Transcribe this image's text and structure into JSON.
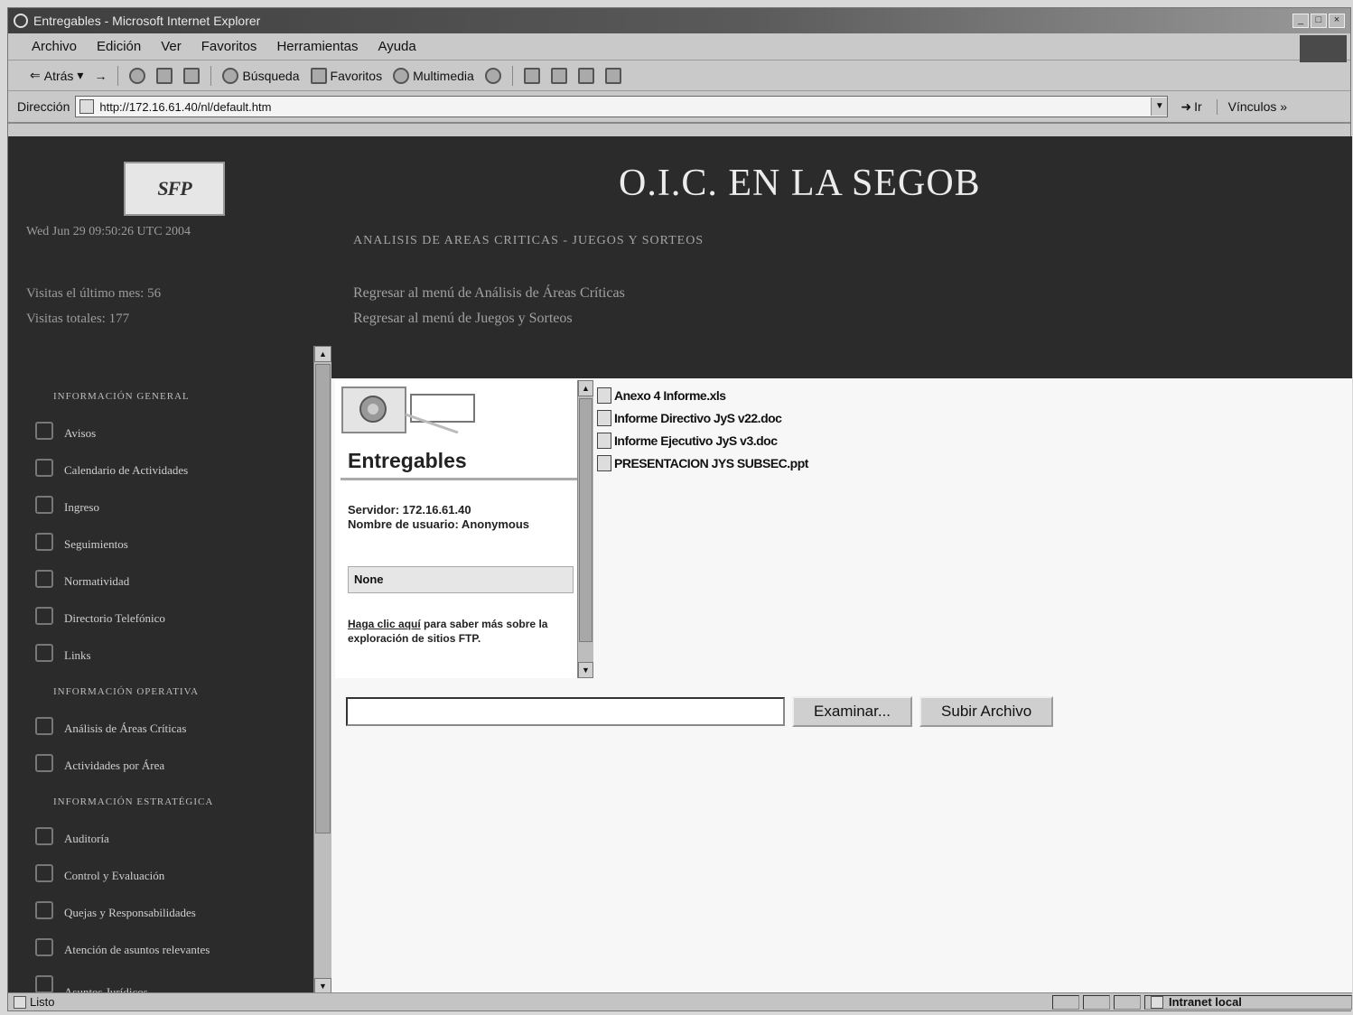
{
  "window": {
    "title": "Entregables - Microsoft Internet Explorer",
    "min": "_",
    "max": "□",
    "close": "×"
  },
  "menu": [
    "Archivo",
    "Edición",
    "Ver",
    "Favoritos",
    "Herramientas",
    "Ayuda"
  ],
  "toolbar": {
    "back": "Atrás",
    "forward": "→",
    "search": "Búsqueda",
    "favorites": "Favoritos",
    "media": "Multimedia"
  },
  "address": {
    "label": "Dirección",
    "url": "http://172.16.61.40/nl/default.htm",
    "go": "Ir",
    "links": "Vínculos"
  },
  "header": {
    "logo": "SFP",
    "datetime": "Wed Jun 29 09:50:26 UTC 2004",
    "visitor_last": "Visitas el último mes: 56",
    "visitor_total": "Visitas totales: 177",
    "site_title": "O.I.C. EN LA SEGOB",
    "subtitle": "ANALISIS DE AREAS CRITICAS - JUEGOS Y SORTEOS",
    "link1": "Regresar al menú de Análisis de Áreas Críticas",
    "link2": "Regresar al menú de Juegos y Sorteos"
  },
  "sidebar": {
    "section1": "INFORMACIÓN GENERAL",
    "items1": [
      "Avisos",
      "Calendario de Actividades",
      "Ingreso",
      "Seguimientos",
      "Normatividad",
      "Directorio Telefónico",
      "Links"
    ],
    "section2": "INFORMACIÓN OPERATIVA",
    "items2": [
      "Análisis de Áreas Críticas",
      "Actividades por Área"
    ],
    "section3": "INFORMACIÓN ESTRATÉGICA",
    "items3": [
      "Auditoría",
      "Control y Evaluación",
      "Quejas y Responsabilidades",
      "Atención de asuntos relevantes",
      "Asuntos Jurídicos"
    ]
  },
  "ftp": {
    "heading": "Entregables",
    "server": "Servidor: 172.16.61.40",
    "user": "Nombre de usuario: Anonymous",
    "select_value": "None",
    "help_link": "Haga clic aquí",
    "help_text": " para saber más sobre la exploración de sitios FTP."
  },
  "files": [
    "Anexo 4 Informe.xls",
    "Informe Directivo JyS v22.doc",
    "Informe Ejecutivo JyS v3.doc",
    "PRESENTACION JYS SUBSEC.ppt"
  ],
  "upload": {
    "browse": "Examinar...",
    "submit": "Subir Archivo"
  },
  "status": {
    "text": "Listo",
    "zone": "Intranet local"
  }
}
